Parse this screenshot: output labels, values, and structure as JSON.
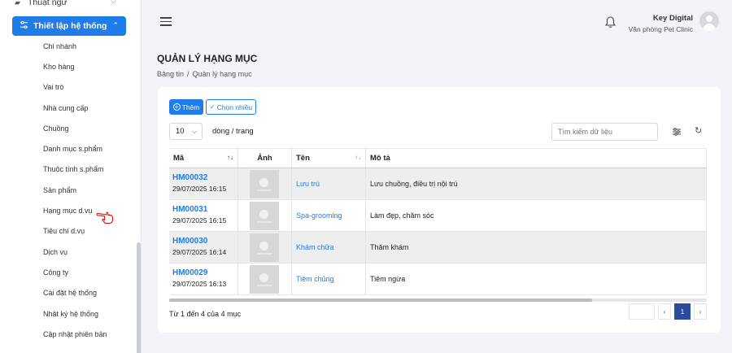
{
  "sidebar": {
    "top_item": "Thuật ngữ",
    "active_item": "Thiết lập hệ thống",
    "items": [
      "Chi nhánh",
      "Kho hàng",
      "Vai trò",
      "Nhà cung cấp",
      "Chuồng",
      "Danh mục s.phẩm",
      "Thuộc tính s.phẩm",
      "Sản phẩm",
      "Hạng mục d.vụ",
      "Tiêu chí d.vụ",
      "Dịch vụ",
      "Công ty",
      "Cài đặt hệ thống",
      "Nhật ký hệ thống",
      "Cập nhật phiên bản"
    ]
  },
  "header": {
    "user_name": "Key Digital",
    "org_name": "Văn phòng Pet Clinic"
  },
  "page": {
    "title": "QUẢN LÝ HẠNG MỤC",
    "breadcrumb_home": "Bảng tin",
    "breadcrumb_sep": "/",
    "breadcrumb_current": "Quản lý hạng mục"
  },
  "toolbar": {
    "add_label": "Thêm",
    "multi_label": "Chọn nhiều",
    "page_size": "10",
    "page_size_label": "dòng / trang",
    "search_placeholder": "Tìm kiếm dữ liệu"
  },
  "table": {
    "columns": [
      "Mã",
      "Ảnh",
      "Tên",
      "Mô tả"
    ],
    "rows": [
      {
        "code": "HM00032",
        "date": "29/07/2025 16:15",
        "name": "Lưu trú",
        "desc": "Lưu chuồng, điều trị nội trú"
      },
      {
        "code": "HM00031",
        "date": "29/07/2025 16:15",
        "name": "Spa-grooming",
        "desc": "Làm đẹp, chăm sóc"
      },
      {
        "code": "HM00030",
        "date": "29/07/2025 16:14",
        "name": "Khám chữa",
        "desc": "Thăm khám"
      },
      {
        "code": "HM00029",
        "date": "29/07/2025 16:13",
        "name": "Tiêm chủng",
        "desc": "Tiêm ngừa"
      }
    ]
  },
  "pagination": {
    "summary": "Từ 1 đến 4 của 4 mục",
    "prev": "‹",
    "current": "1",
    "next": "›"
  },
  "colors": {
    "accent": "#1f7ce8",
    "pager_active": "#2a4a9c"
  }
}
